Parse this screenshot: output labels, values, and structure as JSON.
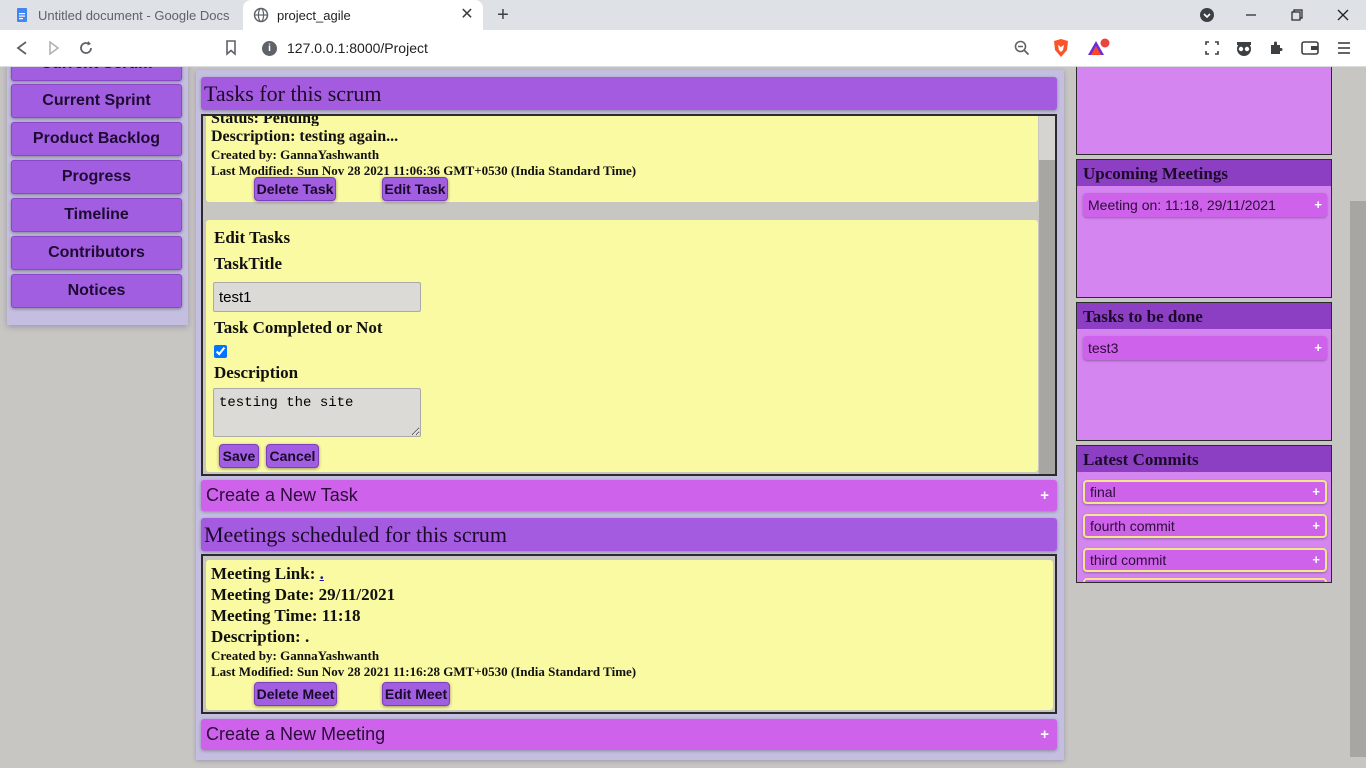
{
  "browser": {
    "tabs": [
      {
        "title": "Untitled document - Google Docs"
      },
      {
        "title": "project_agile"
      }
    ],
    "url": "127.0.0.1:8000/Project",
    "new_tab": "+",
    "close": "✕"
  },
  "sidebar": {
    "items": [
      {
        "label": "Current Scrum"
      },
      {
        "label": "Current Sprint"
      },
      {
        "label": "Product Backlog"
      },
      {
        "label": "Progress"
      },
      {
        "label": "Timeline"
      },
      {
        "label": "Contributors"
      },
      {
        "label": "Notices"
      }
    ]
  },
  "tasks_section": {
    "title": "Tasks for this scrum",
    "task": {
      "status_line": "Status: Pending",
      "description": "Description: testing again...",
      "created_by": "Created by: GannaYashwanth",
      "last_modified": "Last Modified: Sun Nov 28 2021 11:06:36 GMT+0530 (India Standard Time)",
      "delete_label": "Delete Task",
      "edit_label": "Edit Task"
    },
    "edit_form": {
      "heading": "Edit Tasks",
      "title_label": "TaskTitle",
      "title_value": "test1",
      "completed_label": "Task Completed or Not",
      "completed": true,
      "description_label": "Description",
      "description_value": "testing the site",
      "save_label": "Save",
      "cancel_label": "Cancel"
    },
    "create_label": "Create a New Task"
  },
  "meetings_section": {
    "title": "Meetings scheduled for this scrum",
    "meeting": {
      "link_label": "Meeting Link:",
      "link_value": ".",
      "date": "Meeting Date: 29/11/2021",
      "time": "Meeting Time: 11:18",
      "description": "Description: .",
      "created_by": "Created by: GannaYashwanth",
      "last_modified": "Last Modified: Sun Nov 28 2021 11:16:28 GMT+0530 (India Standard Time)",
      "delete_label": "Delete Meet",
      "edit_label": "Edit Meet"
    },
    "create_label": "Create a New Meeting"
  },
  "right_panel": {
    "upcoming": {
      "title": "Upcoming Meetings",
      "items": [
        "Meeting on: 11:18, 29/11/2021"
      ]
    },
    "todo": {
      "title": "Tasks to be done",
      "items": [
        "test3"
      ]
    },
    "commits": {
      "title": "Latest Commits",
      "items": [
        "final",
        "fourth commit",
        "third commit"
      ]
    }
  },
  "icons": {
    "plus": "+"
  },
  "colors": {
    "accent_purple": "#a55be0",
    "pink_bar": "#cf62ea",
    "card_yellow": "#fafaa2",
    "right_header": "#8c3fc2"
  }
}
